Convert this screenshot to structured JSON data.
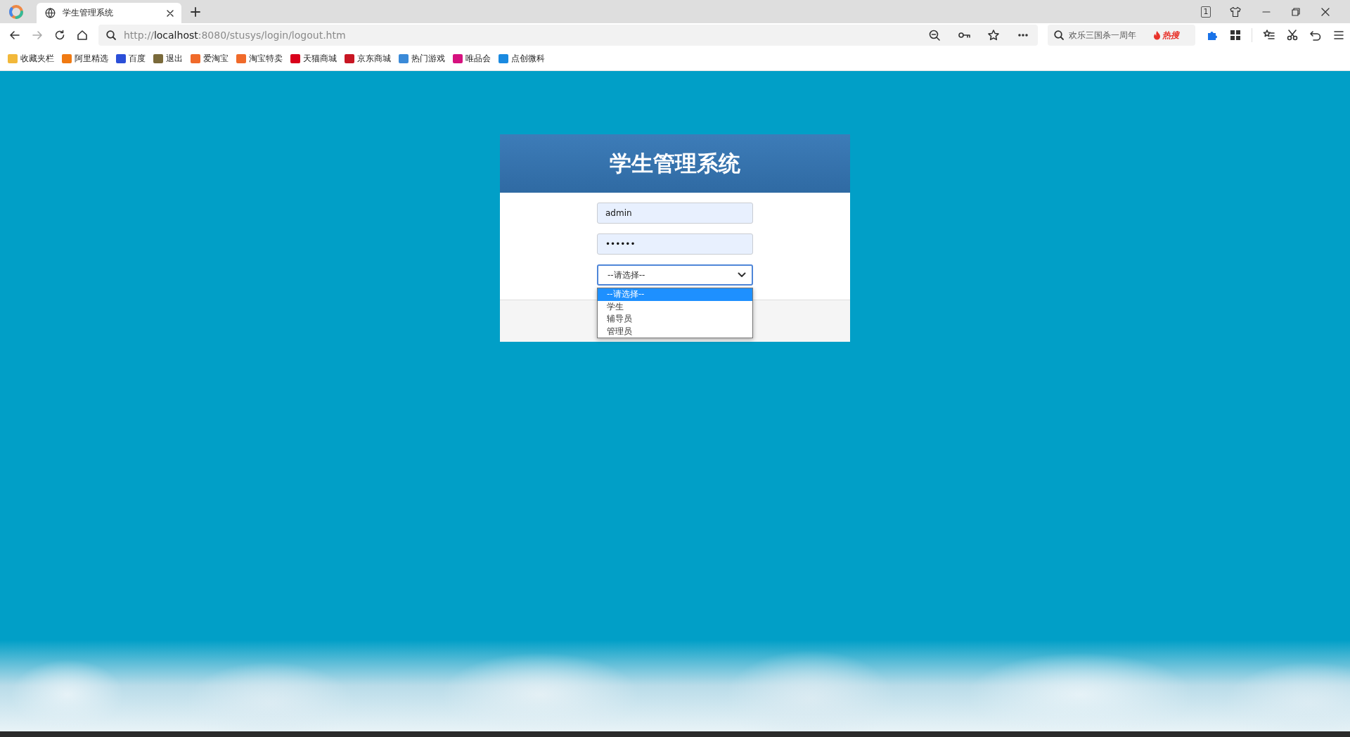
{
  "browser": {
    "tab": {
      "title": "学生管理系统"
    },
    "address": {
      "scheme": "http://",
      "host": "localhost",
      "path": ":8080/stusys/login/logout.htm"
    },
    "search": {
      "value": "欢乐三国杀一周年",
      "hot_badge": "热搜"
    },
    "tab_count": "1",
    "bookmarks": [
      {
        "label": "收藏夹栏",
        "color": "#f2b83a"
      },
      {
        "label": "阿里精选",
        "color": "#f07a12"
      },
      {
        "label": "百度",
        "color": "#2b4fd8"
      },
      {
        "label": "退出",
        "color": "#7a6a3a"
      },
      {
        "label": "爱淘宝",
        "color": "#f06a2a"
      },
      {
        "label": "淘宝特卖",
        "color": "#f06a2a"
      },
      {
        "label": "天猫商城",
        "color": "#d9001b"
      },
      {
        "label": "京东商城",
        "color": "#c81623"
      },
      {
        "label": "热门游戏",
        "color": "#3a8ad8"
      },
      {
        "label": "唯品会",
        "color": "#d6117f"
      },
      {
        "label": "点创微科",
        "color": "#1a8ae0"
      }
    ]
  },
  "login": {
    "title": "学生管理系统",
    "username": "admin",
    "password": "••••••",
    "role": {
      "value": "--请选择--",
      "expanded": true,
      "options": [
        {
          "label": "--请选择--",
          "selected": true
        },
        {
          "label": "学生",
          "selected": false
        },
        {
          "label": "辅导员",
          "selected": false
        },
        {
          "label": "管理员",
          "selected": false
        }
      ]
    }
  }
}
